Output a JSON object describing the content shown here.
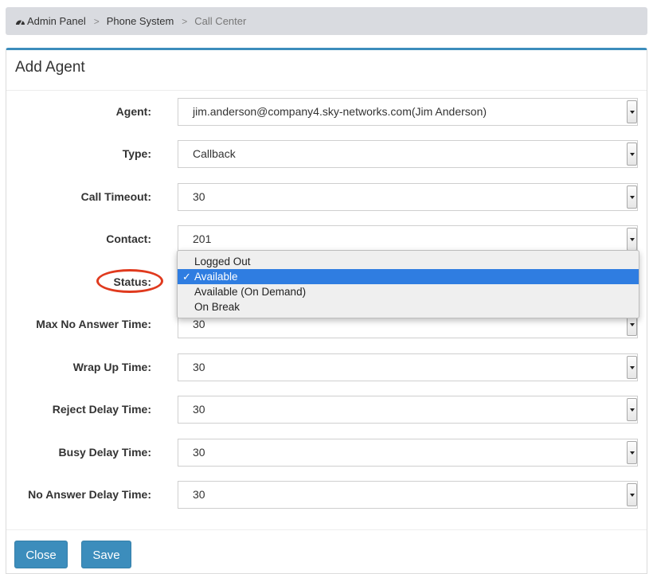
{
  "breadcrumb": {
    "items": [
      "Admin Panel",
      "Phone System",
      "Call Center"
    ],
    "separator": ">"
  },
  "panel": {
    "title": "Add Agent",
    "accent_color": "#3c8dbc"
  },
  "form": {
    "agent": {
      "label": "Agent:",
      "value": "jim.anderson@company4.sky-networks.com(Jim Anderson)"
    },
    "type": {
      "label": "Type:",
      "value": "Callback"
    },
    "call_timeout": {
      "label": "Call Timeout:",
      "value": "30"
    },
    "contact": {
      "label": "Contact:",
      "value": "201"
    },
    "status": {
      "label": "Status:",
      "options": [
        "Logged Out",
        "Available",
        "Available (On Demand)",
        "On Break"
      ],
      "selected": "Available",
      "check_mark": "✓"
    },
    "max_no_answer_time": {
      "label": "Max No Answer Time:",
      "value": "30"
    },
    "wrap_up_time": {
      "label": "Wrap Up Time:",
      "value": "30"
    },
    "reject_delay_time": {
      "label": "Reject Delay Time:",
      "value": "30"
    },
    "busy_delay_time": {
      "label": "Busy Delay Time:",
      "value": "30"
    },
    "no_answer_delay_time": {
      "label": "No Answer Delay Time:",
      "value": "30"
    }
  },
  "buttons": {
    "close": "Close",
    "save": "Save"
  },
  "colors": {
    "highlight_circle": "#e03a1e",
    "selected_option": "#2f7de1",
    "button": "#3c8dbc"
  }
}
